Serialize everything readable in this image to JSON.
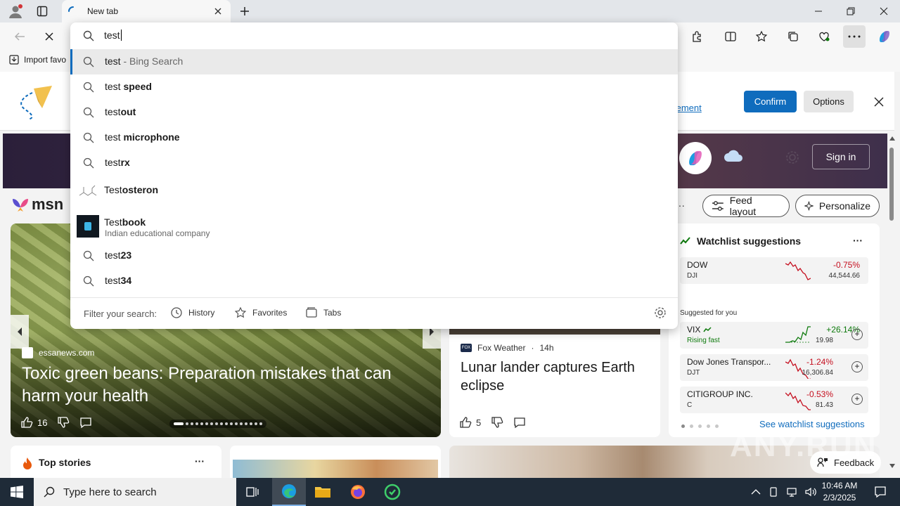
{
  "browser": {
    "tab_title": "New tab",
    "favorites_bar": {
      "import_label": "Import favo"
    }
  },
  "omnibox": {
    "query": "test",
    "suggestions": [
      {
        "prefix": "test",
        "bold": "",
        "hint": " - Bing Search",
        "sub": ""
      },
      {
        "prefix": "test ",
        "bold": "speed",
        "hint": "",
        "sub": ""
      },
      {
        "prefix": "test",
        "bold": "out",
        "hint": "",
        "sub": ""
      },
      {
        "prefix": "test ",
        "bold": "microphone",
        "hint": "",
        "sub": ""
      },
      {
        "prefix": "test",
        "bold": "rx",
        "hint": "",
        "sub": ""
      },
      {
        "prefix": "Test",
        "bold": "osteron",
        "hint": "",
        "sub": ""
      },
      {
        "prefix": "Test",
        "bold": "book",
        "hint": "",
        "sub": "Indian educational company"
      },
      {
        "prefix": "test",
        "bold": "23",
        "hint": "",
        "sub": ""
      },
      {
        "prefix": "test",
        "bold": "34",
        "hint": "",
        "sub": ""
      }
    ],
    "filter_label": "Filter your search:",
    "filters": {
      "history": "History",
      "favorites": "Favorites",
      "tabs": "Tabs"
    }
  },
  "notification": {
    "link_text": "tement",
    "confirm_label": "Confirm",
    "options_label": "Options"
  },
  "msn": {
    "logo_text": "msn",
    "sign_in": "Sign in",
    "feed_layout": "Feed layout",
    "personalize": "Personalize",
    "more": "···"
  },
  "hero": {
    "source": "essanews.com",
    "title": "Toxic green beans: Preparation mistakes that can harm your health",
    "likes": "16"
  },
  "news2": {
    "source": "Fox Weather",
    "age": "14h",
    "title": "Lunar lander captures Earth eclipse",
    "likes": "5"
  },
  "watchlist": {
    "title": "Watchlist suggestions",
    "more": "···",
    "top": {
      "name": "DOW",
      "sym": "DJI",
      "change": "-0.75%",
      "price": "44,544.66"
    },
    "suggested_label": "Suggested for you",
    "items": [
      {
        "name": "VIX",
        "sym": "Rising fast",
        "change": "+26.14%",
        "price": "19.98"
      },
      {
        "name": "Dow Jones Transpor...",
        "sym": "DJT",
        "change": "-1.24%",
        "price": "16,306.84"
      },
      {
        "name": "CITIGROUP INC.",
        "sym": "C",
        "change": "-0.53%",
        "price": "81.43"
      }
    ],
    "see_all": "See watchlist suggestions",
    "colors": {
      "negative": "#c50f1f",
      "positive": "#0e7a0d"
    }
  },
  "top_stories": {
    "title": "Top stories",
    "more": "···"
  },
  "feedback": "Feedback",
  "watermark": "ANY.RUN",
  "taskbar": {
    "search_placeholder": "Type here to search",
    "time": "10:46 AM",
    "date": "2/3/2025"
  }
}
